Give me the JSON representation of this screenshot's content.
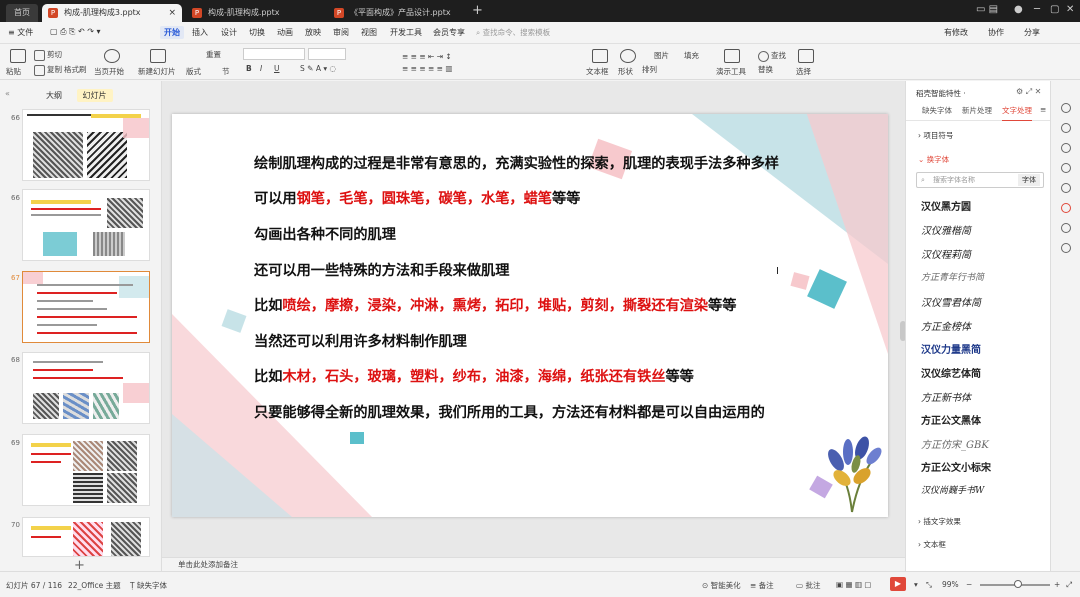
{
  "tabs": [
    {
      "label": "首页"
    },
    {
      "label": "构成-肌理构成3.pptx"
    },
    {
      "label": "构成-肌理构成.pptx"
    },
    {
      "label": "《平面构成》产品设计.pptx"
    }
  ],
  "menu": {
    "file": "≡ 文件",
    "items": [
      "开始",
      "插入",
      "设计",
      "切换",
      "动画",
      "放映",
      "审阅",
      "视图",
      "开发工具",
      "会员专享"
    ],
    "search_placeholder": "查找命令、搜索模板",
    "right": [
      "有修改",
      "协作",
      "分享"
    ]
  },
  "ribbon": {
    "items": [
      "粘贴",
      "剪切",
      "复制",
      "格式刷",
      "当页开始",
      "新建幻灯片",
      "版式",
      "节",
      "重置",
      "B",
      "I",
      "U",
      "文本框",
      "形状",
      "排列",
      "图片",
      "填充",
      "演示工具",
      "查找",
      "替换",
      "选择"
    ]
  },
  "left_panel": {
    "tabs": [
      "大纲",
      "幻灯片"
    ],
    "slide_numbers": [
      "66",
      "66",
      "67",
      "68",
      "69",
      "70"
    ]
  },
  "slide": {
    "lines": [
      {
        "parts": [
          {
            "t": "绘制肌理构成的过程是非常有意思的，充满实验性的探索，肌理的表现手法多种多样",
            "r": false
          }
        ]
      },
      {
        "parts": [
          {
            "t": "可以用",
            "r": false
          },
          {
            "t": "钢笔，毛笔，圆珠笔，碳笔，水笔，蜡笔",
            "r": true
          },
          {
            "t": "等等",
            "r": false
          }
        ]
      },
      {
        "parts": [
          {
            "t": "勾画出各种不同的肌理",
            "r": false
          }
        ]
      },
      {
        "parts": [
          {
            "t": "还可以用一些特殊的方法和手段来做肌理",
            "r": false
          }
        ]
      },
      {
        "parts": [
          {
            "t": "比如",
            "r": false
          },
          {
            "t": "喷绘，摩擦，浸染，冲淋，熏烤，拓印，堆贴，剪刻，撕裂还有渲染",
            "r": true
          },
          {
            "t": "等等",
            "r": false
          }
        ]
      },
      {
        "parts": [
          {
            "t": "当然还可以利用许多材料制作肌理",
            "r": false
          }
        ]
      },
      {
        "parts": [
          {
            "t": "比如",
            "r": false
          },
          {
            "t": "木材，石头，玻璃，塑料，纱布，油漆，海绵，纸张还有铁丝",
            "r": true
          },
          {
            "t": "等等",
            "r": false
          }
        ]
      },
      {
        "parts": [
          {
            "t": "只要能够得全新的肌理效果，我们所用的工具，方法还有材料都是可以自由运用的",
            "r": false
          }
        ]
      }
    ]
  },
  "notes_placeholder": "单击此处添加备注",
  "right_panel": {
    "title": "稻壳智能特性 ·",
    "tabs": [
      "缺失字体",
      "新片处理",
      "文字处理"
    ],
    "sections": [
      "项目符号",
      "换字体"
    ],
    "search_placeholder": "搜索字体名称",
    "search_button": "字体",
    "fonts": [
      "汉仪黑方圆",
      "汉仪雅楷简",
      "汉仪程莉简",
      "方正青年行书简",
      "汉仪雪君体简",
      "方正金榜体",
      "汉仪力量黑简",
      "汉仪综艺体简",
      "方正新书体",
      "方正公文黑体",
      "方正仿宋_GBK",
      "方正公文小标宋",
      "汉仪尚巍手书W"
    ],
    "bottom": [
      "插文字效果",
      "文本框"
    ]
  },
  "status": {
    "slide_count": "幻灯片 67 / 116",
    "theme": "22_Office 主题",
    "font_missing": "缺失字体",
    "smart": "智能美化",
    "notes": "备注",
    "comments": "批注",
    "zoom": "99%"
  },
  "colors": {
    "accent": "#e0483a",
    "red_text": "#dd1111",
    "pink": "#f6c3c8",
    "teal": "#c7e3e8"
  }
}
